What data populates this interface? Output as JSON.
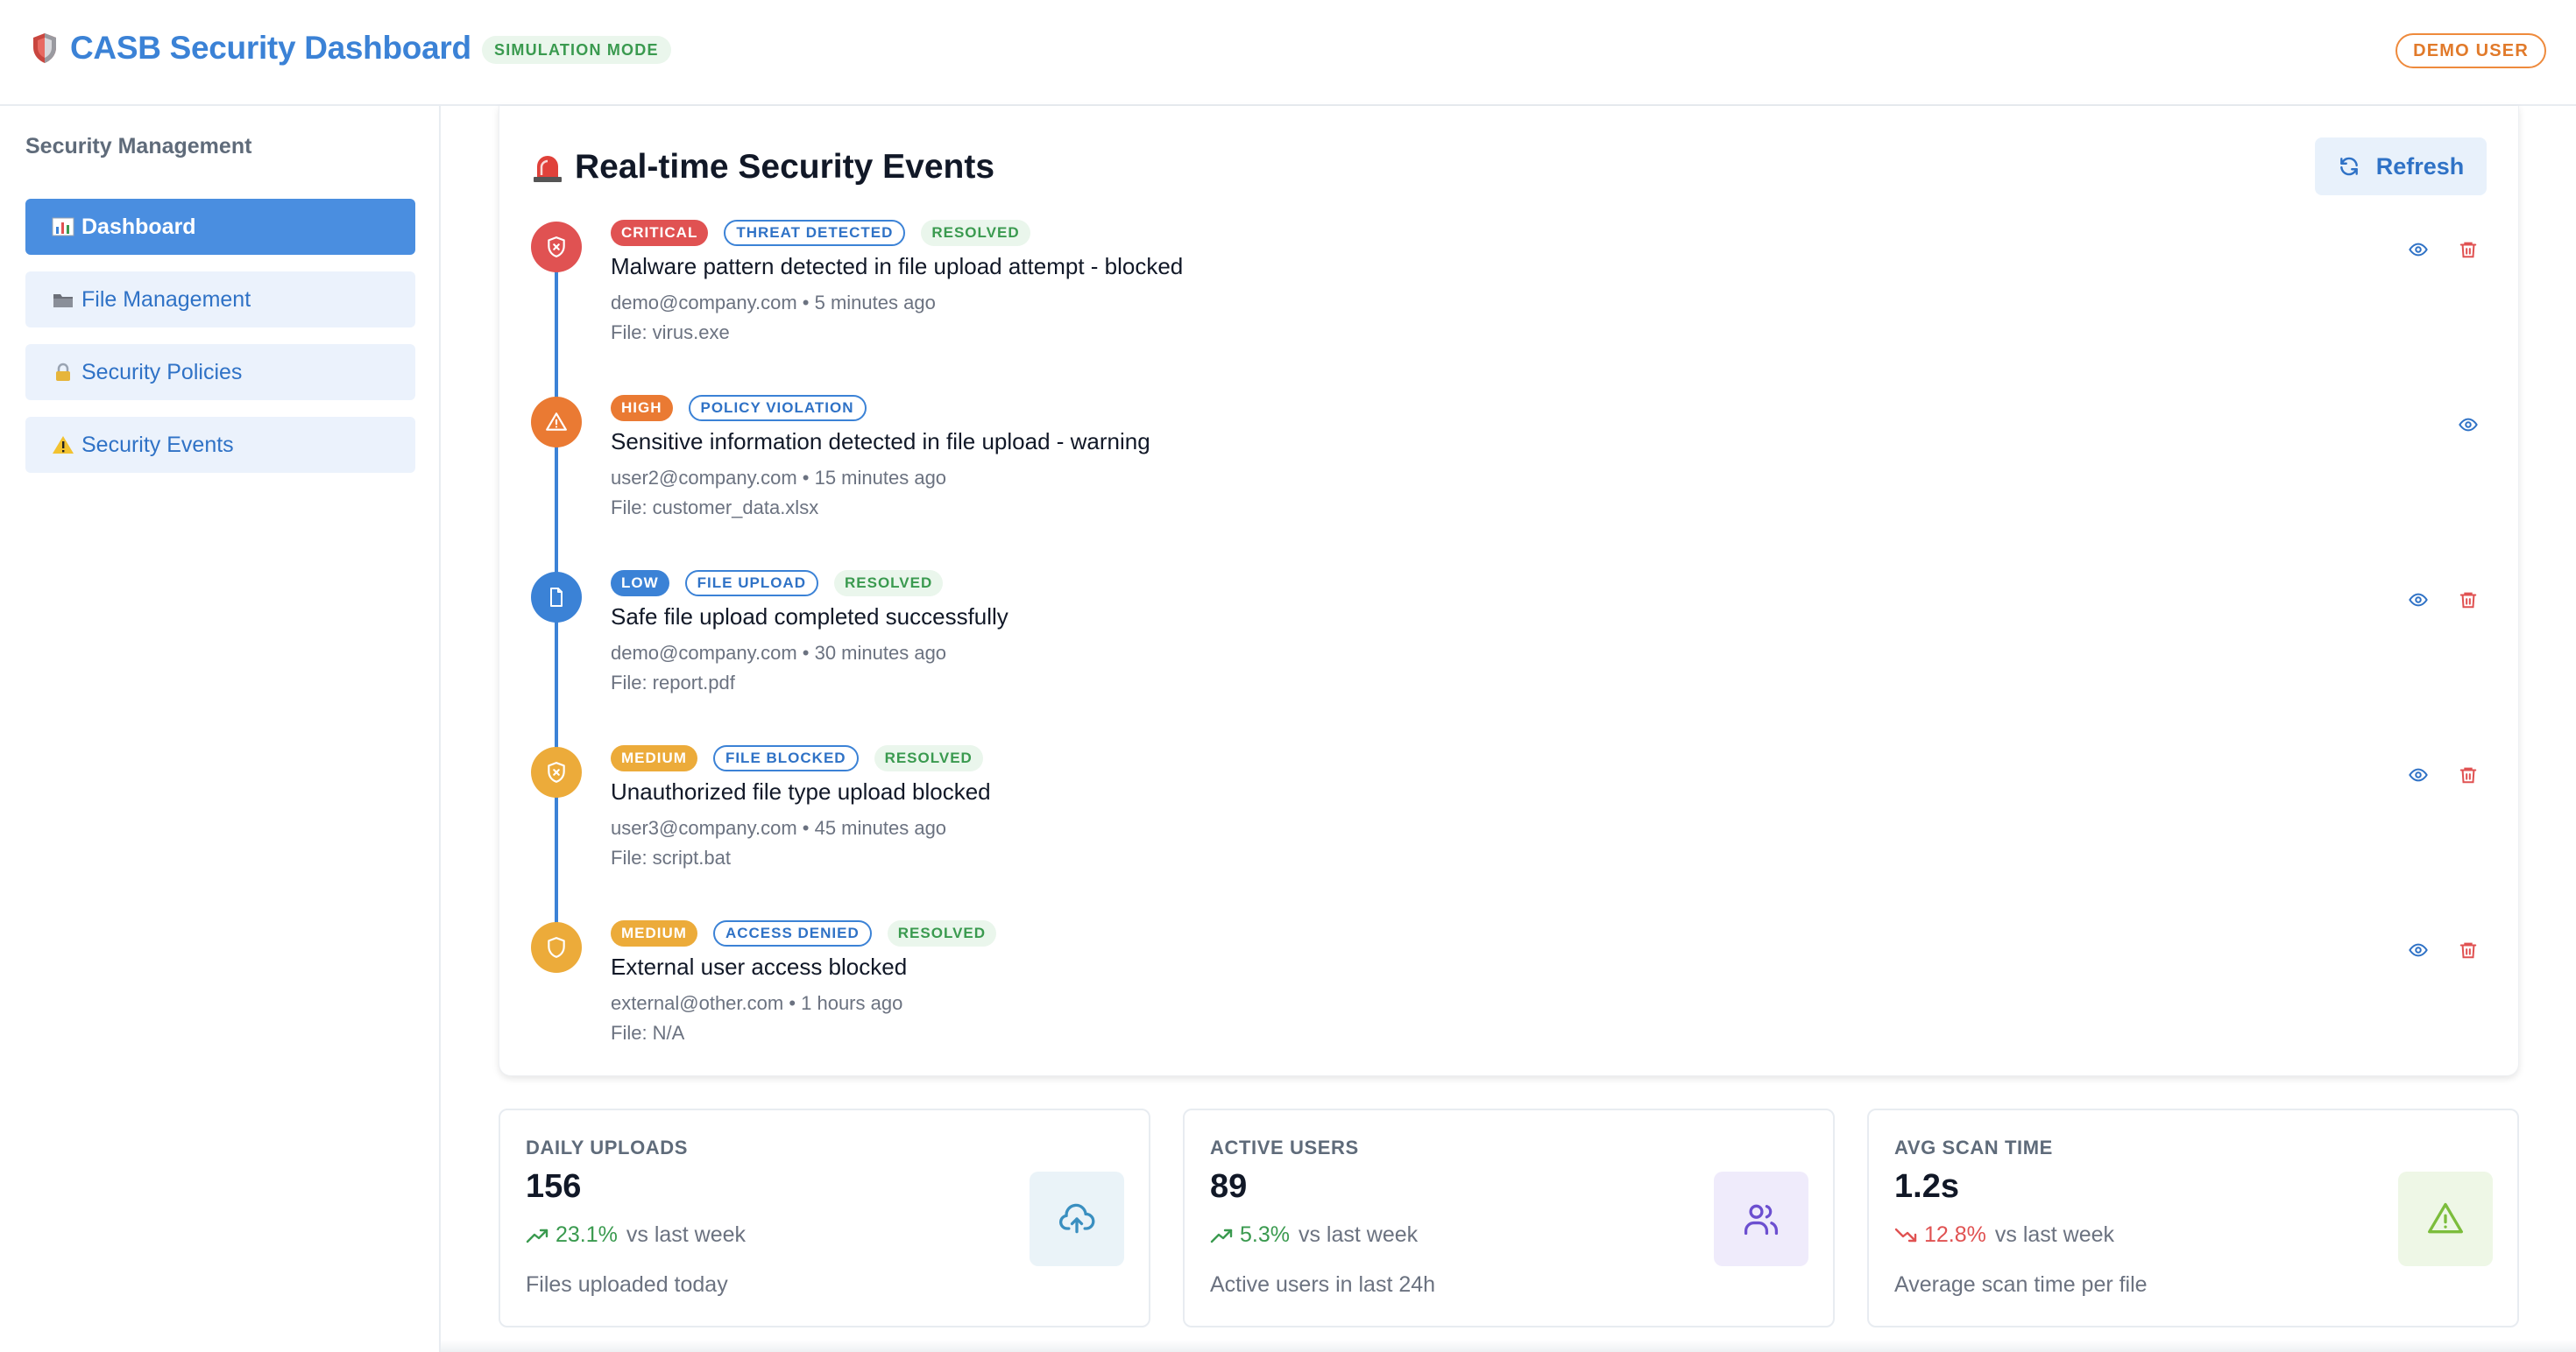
{
  "header": {
    "title": "CASB Security Dashboard",
    "mode_badge": "SIMULATION MODE",
    "user_badge": "DEMO USER"
  },
  "sidebar": {
    "heading": "Security Management",
    "items": [
      {
        "label": "Dashboard",
        "icon": "bar-chart-icon",
        "active": true
      },
      {
        "label": "File Management",
        "icon": "folder-icon",
        "active": false
      },
      {
        "label": "Security Policies",
        "icon": "lock-icon",
        "active": false
      },
      {
        "label": "Security Events",
        "icon": "warning-icon",
        "active": false
      }
    ]
  },
  "events": {
    "title": "Real-time Security Events",
    "refresh_label": "Refresh",
    "items": [
      {
        "severity": "CRITICAL",
        "severity_color": "#e05252",
        "type": "THREAT DETECTED",
        "status": "RESOLVED",
        "title": "Malware pattern detected in file upload attempt - blocked",
        "meta": "demo@company.com • 5 minutes ago",
        "file": "File: virus.exe",
        "icon": "shield-x-icon",
        "can_delete": true
      },
      {
        "severity": "HIGH",
        "severity_color": "#ea7a33",
        "type": "POLICY VIOLATION",
        "status": "",
        "title": "Sensitive information detected in file upload - warning",
        "meta": "user2@company.com • 15 minutes ago",
        "file": "File: customer_data.xlsx",
        "icon": "alert-triangle-icon",
        "can_delete": false
      },
      {
        "severity": "LOW",
        "severity_color": "#3b82d6",
        "type": "FILE UPLOAD",
        "status": "RESOLVED",
        "title": "Safe file upload completed successfully",
        "meta": "demo@company.com • 30 minutes ago",
        "file": "File: report.pdf",
        "icon": "file-icon",
        "can_delete": true
      },
      {
        "severity": "MEDIUM",
        "severity_color": "#ecab3a",
        "type": "FILE BLOCKED",
        "status": "RESOLVED",
        "title": "Unauthorized file type upload blocked",
        "meta": "user3@company.com • 45 minutes ago",
        "file": "File: script.bat",
        "icon": "shield-x-icon",
        "can_delete": true
      },
      {
        "severity": "MEDIUM",
        "severity_color": "#ecab3a",
        "type": "ACCESS DENIED",
        "status": "RESOLVED",
        "title": "External user access blocked",
        "meta": "external@other.com • 1 hours ago",
        "file": "File: N/A",
        "icon": "shield-icon",
        "can_delete": true
      }
    ]
  },
  "stats": [
    {
      "label": "DAILY UPLOADS",
      "value": "156",
      "trend_direction": "up",
      "trend_pct": "23.1%",
      "trend_text": "vs last week",
      "description": "Files uploaded today",
      "icon": "cloud-upload-icon",
      "icon_bg": "#eaf3f8",
      "icon_color": "#3a8fc0"
    },
    {
      "label": "ACTIVE USERS",
      "value": "89",
      "trend_direction": "up",
      "trend_pct": "5.3%",
      "trend_text": "vs last week",
      "description": "Active users in last 24h",
      "icon": "users-icon",
      "icon_bg": "#efebfb",
      "icon_color": "#6c4fd0"
    },
    {
      "label": "AVG SCAN TIME",
      "value": "1.2s",
      "trend_direction": "down",
      "trend_pct": "12.8%",
      "trend_text": "vs last week",
      "description": "Average scan time per file",
      "icon": "alert-triangle-icon",
      "icon_bg": "#eef7e6",
      "icon_color": "#7cbd3c"
    }
  ],
  "colors": {
    "accent": "#3b82d6",
    "trend_up": "#3a9a4f",
    "trend_down": "#e05252",
    "delete": "#e05252"
  }
}
